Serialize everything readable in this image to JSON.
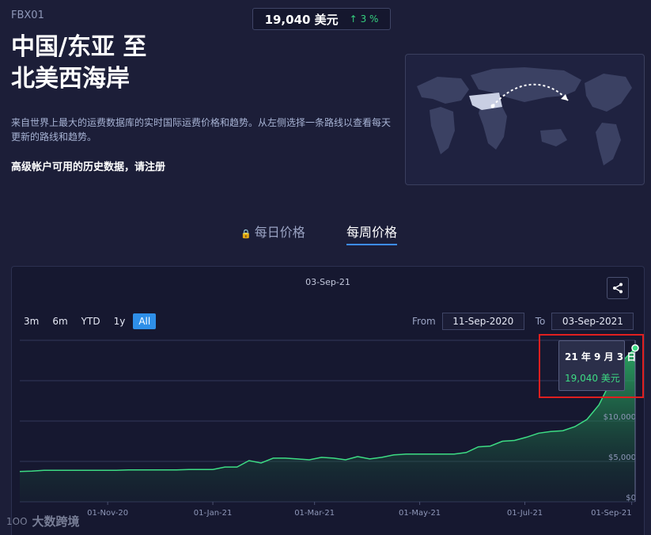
{
  "header": {
    "code": "FBX01",
    "price": "19,040 美元",
    "change": "3 %",
    "change_arrow": "↑",
    "title_line1": "中国/东亚 至",
    "title_line2": "北美西海岸",
    "description": "来自世界上最大的运费数据库的实时国际运费价格和趋势。从左侧选择一条路线以查看每天更新的路线和趋势。",
    "premium": "高级帐户可用的历史数据，请注册"
  },
  "tabs": [
    {
      "label": "每日价格",
      "icon": "lock-icon",
      "active": false
    },
    {
      "label": "每周价格",
      "active": true
    }
  ],
  "chart_panel": {
    "date_title": "03-Sep-21",
    "ranges": [
      "3m",
      "6m",
      "YTD",
      "1y",
      "All"
    ],
    "active_range": "All",
    "from_label": "From",
    "from_value": "11-Sep-2020",
    "to_label": "To",
    "to_value": "03-Sep-2021",
    "share_icon": "share-icon"
  },
  "tooltip": {
    "date": "21 年 9 月 3 日",
    "value": "19,040 美元"
  },
  "watermark": {
    "logo": "1OO",
    "text": "大数跨境"
  },
  "colors": {
    "accent": "#3d8dfb",
    "line": "#3ddc84",
    "highlight": "#e01f1f"
  },
  "chart_data": {
    "type": "area",
    "x_ticks": [
      "01-Nov-20",
      "01-Jan-21",
      "01-Mar-21",
      "01-May-21",
      "01-Jul-21",
      "01-Sep-21"
    ],
    "y_ticks": [
      "$0",
      "$5,000",
      "$10,000"
    ],
    "ylim": [
      0,
      20000
    ],
    "series": [
      {
        "x": [
          "11-Sep-2020",
          "18-Sep-2020",
          "25-Sep-2020",
          "02-Oct-2020",
          "09-Oct-2020",
          "16-Oct-2020",
          "23-Oct-2020",
          "30-Oct-2020",
          "06-Nov-2020",
          "13-Nov-2020",
          "20-Nov-2020",
          "27-Nov-2020",
          "04-Dec-2020",
          "11-Dec-2020",
          "18-Dec-2020",
          "25-Dec-2020",
          "01-Jan-2021",
          "08-Jan-2021",
          "15-Jan-2021",
          "22-Jan-2021",
          "29-Jan-2021",
          "05-Feb-2021",
          "12-Feb-2021",
          "19-Feb-2021",
          "26-Feb-2021",
          "05-Mar-2021",
          "12-Mar-2021",
          "19-Mar-2021",
          "26-Mar-2021",
          "02-Apr-2021",
          "09-Apr-2021",
          "16-Apr-2021",
          "23-Apr-2021",
          "30-Apr-2021",
          "07-May-2021",
          "14-May-2021",
          "21-May-2021",
          "28-May-2021",
          "04-Jun-2021",
          "11-Jun-2021",
          "18-Jun-2021",
          "25-Jun-2021",
          "02-Jul-2021",
          "09-Jul-2021",
          "16-Jul-2021",
          "23-Jul-2021",
          "30-Jul-2021",
          "06-Aug-2021",
          "13-Aug-2021",
          "20-Aug-2021",
          "27-Aug-2021",
          "03-Sep-2021"
        ],
        "values": [
          3750,
          3800,
          3900,
          3900,
          3900,
          3900,
          3900,
          3900,
          3900,
          3950,
          3950,
          3950,
          3950,
          3950,
          4000,
          4000,
          4000,
          4300,
          4300,
          5100,
          4800,
          5400,
          5400,
          5300,
          5200,
          5500,
          5400,
          5200,
          5600,
          5300,
          5500,
          5800,
          5900,
          5900,
          5900,
          5900,
          5900,
          6100,
          6800,
          6900,
          7500,
          7600,
          8000,
          8500,
          8700,
          8800,
          9300,
          10200,
          12000,
          15000,
          17500,
          19040
        ]
      }
    ]
  }
}
